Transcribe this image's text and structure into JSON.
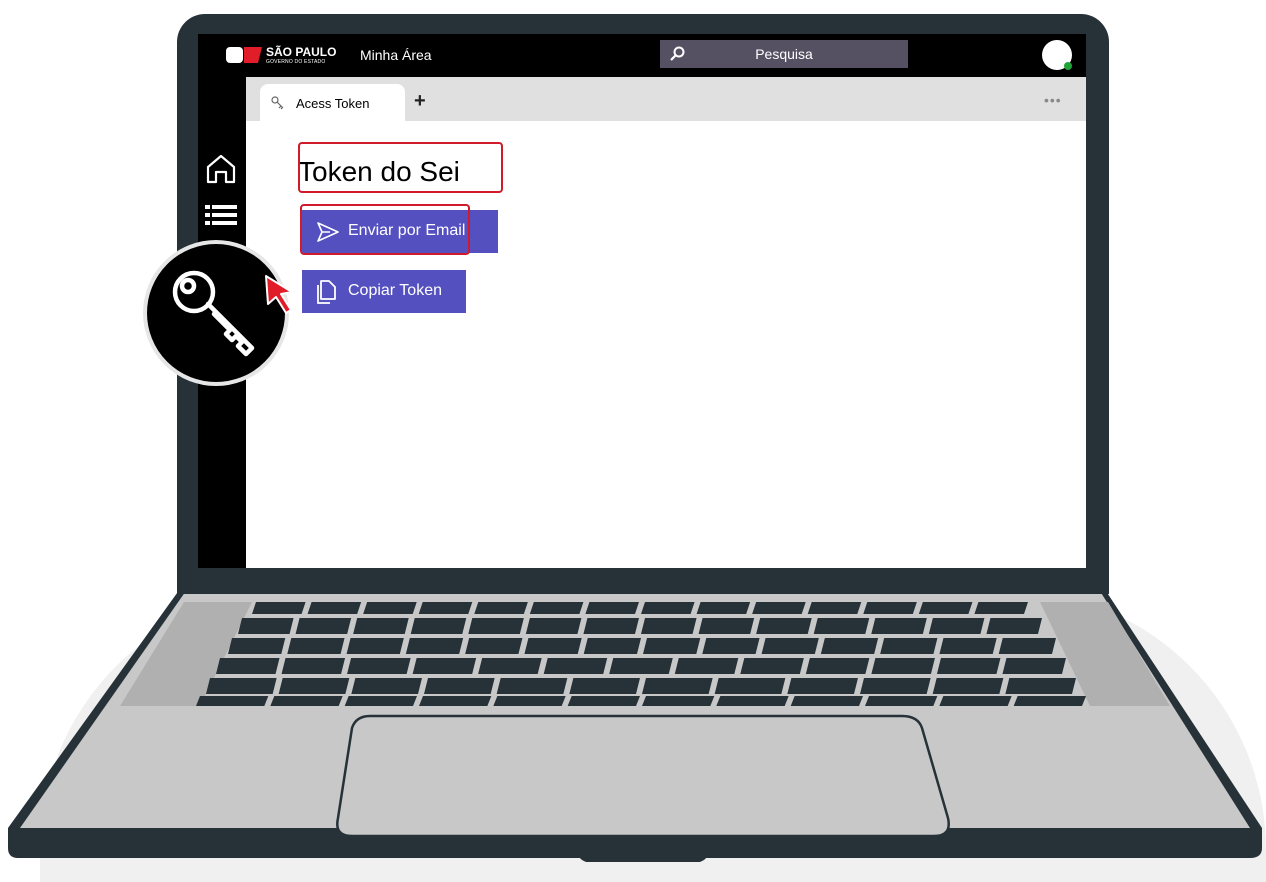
{
  "header": {
    "logo_title": "SÃO PAULO",
    "logo_subtitle": "GOVERNO DO ESTADO",
    "area_label": "Minha Área",
    "search_placeholder": "Pesquisa"
  },
  "tabs": [
    {
      "label": "Acess Token",
      "icon": "key-icon"
    }
  ],
  "tab_more": "•••",
  "sidebar": {
    "items": [
      {
        "icon": "home-icon"
      },
      {
        "icon": "list-icon"
      },
      {
        "icon": "key-icon"
      }
    ]
  },
  "main": {
    "title": "Token do Sei",
    "send_email_label": "Enviar por Email",
    "copy_token_label": "Copiar Token"
  },
  "colors": {
    "accent": "#5550c0",
    "highlight": "#d11b2a",
    "topbar": "#000000",
    "frame": "#263238",
    "status_online": "#22a33a"
  }
}
